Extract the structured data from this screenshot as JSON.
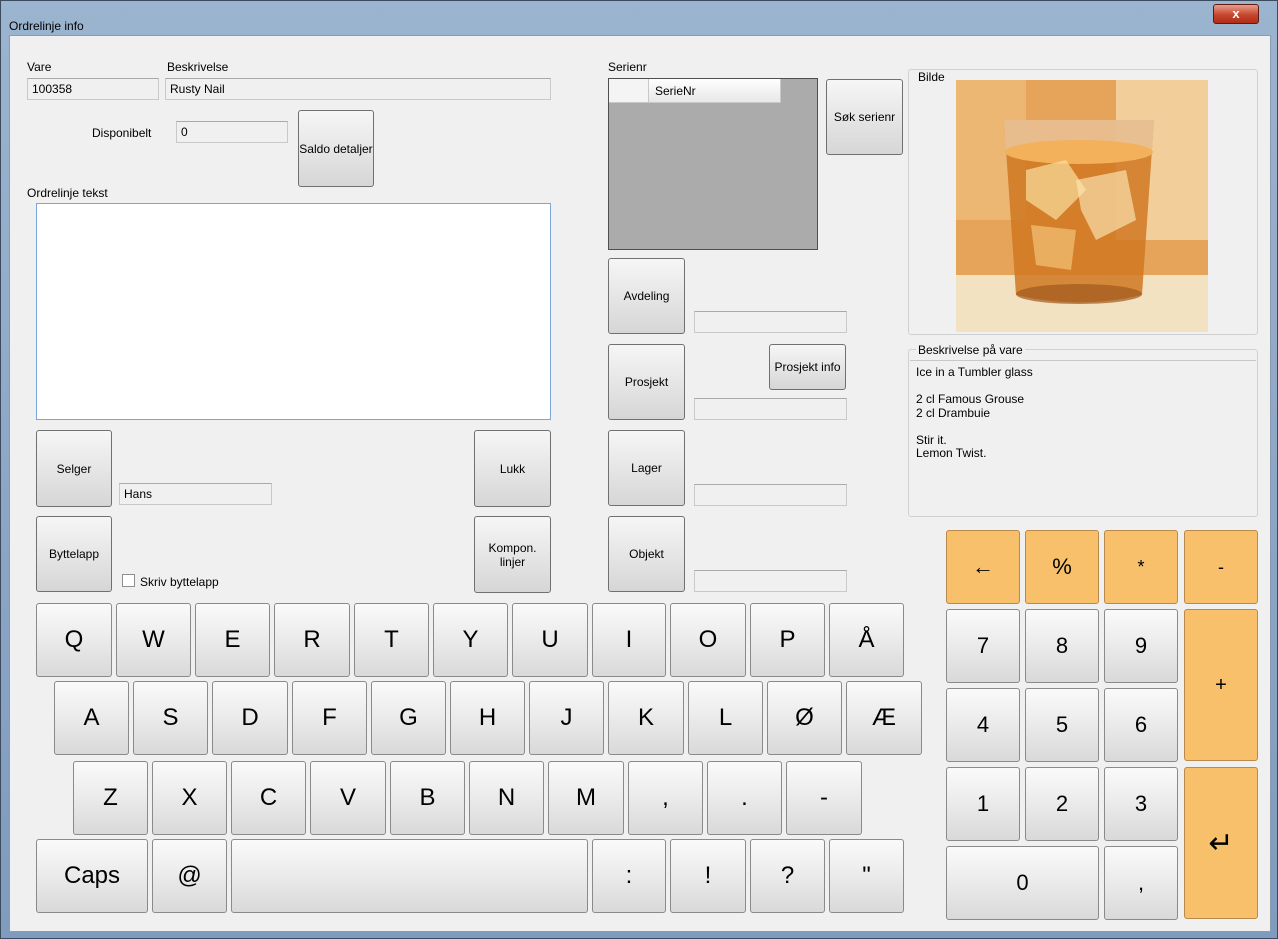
{
  "window": {
    "title": "Ordrelinje info",
    "close_label": "x"
  },
  "vare": {
    "label": "Vare",
    "value": "100358"
  },
  "beskrivelse": {
    "label": "Beskrivelse",
    "value": "Rusty Nail"
  },
  "disponibelt": {
    "label": "Disponibelt",
    "value": "0"
  },
  "saldo_button": "Saldo detaljer",
  "ordrelinje": {
    "label": "Ordrelinje tekst",
    "value": ""
  },
  "serienr": {
    "label": "Serienr",
    "column": "SerieNr",
    "search_button": "Søk serienr"
  },
  "avdeling": {
    "button": "Avdeling",
    "value": ""
  },
  "prosjekt": {
    "button": "Prosjekt",
    "info_button": "Prosjekt info",
    "value": ""
  },
  "lager": {
    "button": "Lager",
    "value": ""
  },
  "objekt": {
    "button": "Objekt",
    "value": ""
  },
  "selger": {
    "button": "Selger",
    "value": "Hans"
  },
  "byttelapp": {
    "button": "Byttelapp",
    "checkbox_label": "Skriv byttelapp",
    "checked": false
  },
  "lukk_button": "Lukk",
  "kompon_button": "Kompon. linjer",
  "bilde": {
    "label": "Bilde"
  },
  "beskrivelse_vare": {
    "label": "Beskrivelse på vare",
    "lines": [
      "Ice in a Tumbler glass",
      "",
      "2 cl Famous Grouse",
      "2 cl Drambuie",
      "",
      "Stir it.",
      "Lemon Twist."
    ]
  },
  "keyboard": {
    "row1": [
      "Q",
      "W",
      "E",
      "R",
      "T",
      "Y",
      "U",
      "I",
      "O",
      "P",
      "Å"
    ],
    "row2": [
      "A",
      "S",
      "D",
      "F",
      "G",
      "H",
      "J",
      "K",
      "L",
      "Ø",
      "Æ"
    ],
    "row3": [
      "Z",
      "X",
      "C",
      "V",
      "B",
      "N",
      "M",
      ",",
      ".",
      "-"
    ],
    "row4": [
      "Caps",
      "@",
      "",
      ":",
      "!",
      "?",
      "\""
    ]
  },
  "numpad": {
    "top": [
      "←",
      "%",
      "*",
      "-"
    ],
    "r1": [
      "7",
      "8",
      "9"
    ],
    "r2": [
      "4",
      "5",
      "6"
    ],
    "r3": [
      "1",
      "2",
      "3"
    ],
    "zero": "0",
    "comma": ",",
    "plus": "+",
    "enter": "↵"
  },
  "colors": {
    "accent": "#f9c06c"
  }
}
